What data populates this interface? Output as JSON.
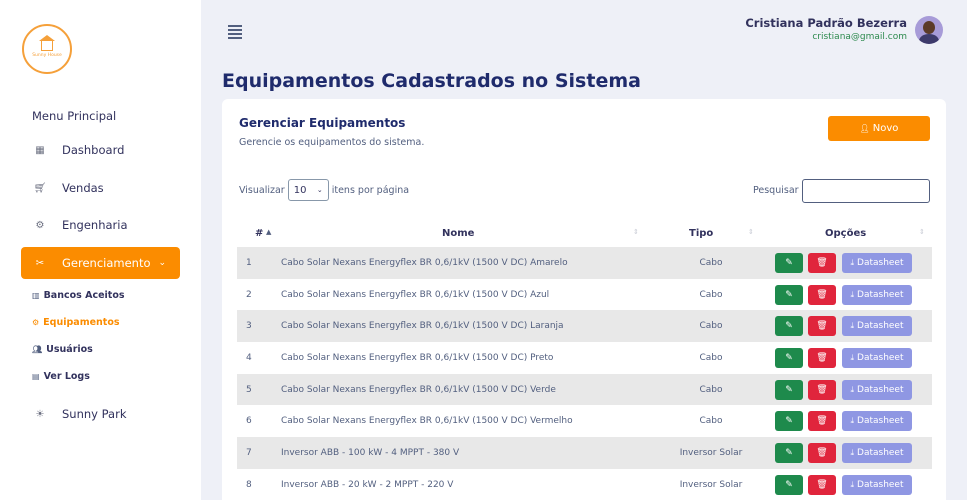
{
  "sidebar": {
    "logo_text": "Sunny House",
    "menu_heading": "Menu Principal",
    "items": [
      {
        "label": "Dashboard",
        "icon": "grid-icon"
      },
      {
        "label": "Vendas",
        "icon": "cart-icon"
      },
      {
        "label": "Engenharia",
        "icon": "gear-icon"
      },
      {
        "label": "Gerenciamento",
        "icon": "tools-icon",
        "active": true
      }
    ],
    "sub_items": [
      {
        "label": "Bancos Aceitos",
        "icon": "bank-icon"
      },
      {
        "label": "Equipamentos",
        "icon": "cog-icon",
        "active": true
      },
      {
        "label": "Usuários",
        "icon": "users-icon"
      },
      {
        "label": "Ver Logs",
        "icon": "file-icon"
      }
    ],
    "extra_item": {
      "label": "Sunny Park",
      "icon": "sun-icon"
    }
  },
  "header": {
    "user_name": "Cristiana Padrão Bezerra",
    "user_email": "cristiana@gmail.com"
  },
  "page_title": "Equipamentos Cadastrados no Sistema",
  "card": {
    "title": "Gerenciar Equipamentos",
    "subtitle": "Gerencie os equipamentos do sistema.",
    "new_button": "Novo",
    "show_prefix": "Visualizar",
    "show_value": "10",
    "show_suffix": "itens por página",
    "search_label": "Pesquisar"
  },
  "table": {
    "headers": [
      "#",
      "Nome",
      "Tipo",
      "Opções"
    ],
    "edit_icon": "pencil-icon",
    "delete_icon": "trash-icon",
    "datasheet_label": "Datasheet",
    "rows": [
      {
        "n": "1",
        "name": "Cabo Solar Nexans Energyflex BR 0,6/1kV (1500 V DC) Amarelo",
        "tipo": "Cabo"
      },
      {
        "n": "2",
        "name": "Cabo Solar Nexans Energyflex BR 0,6/1kV (1500 V DC) Azul",
        "tipo": "Cabo"
      },
      {
        "n": "3",
        "name": "Cabo Solar Nexans Energyflex BR 0,6/1kV (1500 V DC) Laranja",
        "tipo": "Cabo"
      },
      {
        "n": "4",
        "name": "Cabo Solar Nexans Energyflex BR 0,6/1kV (1500 V DC) Preto",
        "tipo": "Cabo"
      },
      {
        "n": "5",
        "name": "Cabo Solar Nexans Energyflex BR 0,6/1kV (1500 V DC) Verde",
        "tipo": "Cabo"
      },
      {
        "n": "6",
        "name": "Cabo Solar Nexans Energyflex BR 0,6/1kV (1500 V DC) Vermelho",
        "tipo": "Cabo"
      },
      {
        "n": "7",
        "name": "Inversor ABB - 100 kW - 4 MPPT - 380 V",
        "tipo": "Inversor Solar"
      },
      {
        "n": "8",
        "name": "Inversor ABB - 20 kW - 2 MPPT - 220 V",
        "tipo": "Inversor Solar"
      }
    ]
  },
  "colors": {
    "accent": "#fb8c00",
    "edit": "#1e8a4c",
    "delete": "#e0253c",
    "datasheet": "#8f97e3",
    "title": "#1f2b6c"
  }
}
